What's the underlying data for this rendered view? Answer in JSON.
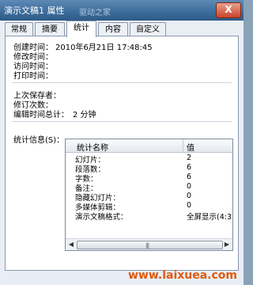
{
  "window": {
    "title": "演示文稿1 属性",
    "faded_text": "驱动之家",
    "close_symbol": "X"
  },
  "tabs": [
    {
      "label": "常规"
    },
    {
      "label": "摘要"
    },
    {
      "label": "统计"
    },
    {
      "label": "内容"
    },
    {
      "label": "自定义"
    }
  ],
  "active_tab": "统计",
  "dates": {
    "created_label": "创建时间：",
    "created_value": "2010年6月21日  17:48:45",
    "modified_label": "修改时间：",
    "accessed_label": "访问时间：",
    "printed_label": "打印时间："
  },
  "save_info": {
    "last_saved_by_label": "上次保存者：",
    "revision_label": "修订次数：",
    "edit_time_label": "编辑时间总计：",
    "edit_time_value": "2 分钟"
  },
  "stats": {
    "label": "统计信息(S)：",
    "columns": [
      "统计名称",
      "值"
    ],
    "rows": [
      {
        "name": "幻灯片：",
        "value": "2"
      },
      {
        "name": "段落数：",
        "value": "6"
      },
      {
        "name": "字数：",
        "value": "6"
      },
      {
        "name": "备注：",
        "value": "0"
      },
      {
        "name": "隐藏幻灯片：",
        "value": "0"
      },
      {
        "name": "多媒体剪辑：",
        "value": "0"
      },
      {
        "name": "演示文稿格式：",
        "value": "全屏显示(4:3)"
      }
    ]
  },
  "scrollbar": {
    "left_arrow": "◀",
    "right_arrow": "▶",
    "grip": "|||"
  },
  "watermark": "www.laixuea.com",
  "colors": {
    "title_bar": "#3e6e9d",
    "close_button": "#c8442a",
    "watermark": "#e05a0c"
  }
}
